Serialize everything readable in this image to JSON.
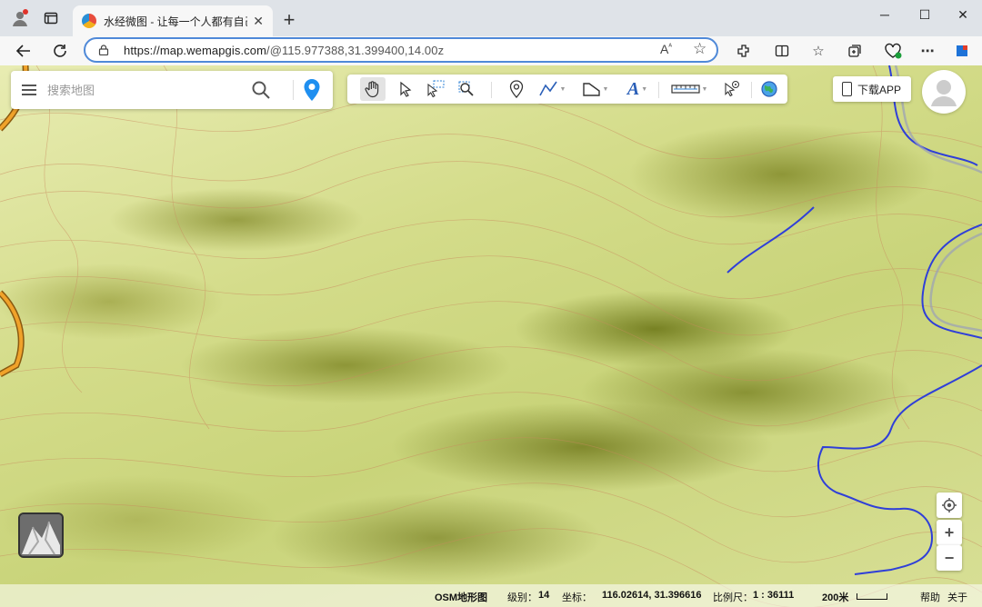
{
  "browser": {
    "tab_title": "水经微图 - 让每一个人都有自己的",
    "url_host": "https://map.wemapgis.com",
    "url_path": "/@115.977388,31.399400,14.00z",
    "read_aloud_label": "Aᵃ"
  },
  "search": {
    "placeholder": "搜索地图"
  },
  "toolbar": {
    "tools": [
      "pan-hand",
      "select-arrow",
      "box-select",
      "zoom-box",
      "marker",
      "polyline",
      "polygon",
      "text",
      "ruler",
      "click-query",
      "globe"
    ],
    "text_tool_label": "A"
  },
  "download_label": "下载APP",
  "statusbar": {
    "layer_name": "OSM地形图",
    "level_label": "级别：",
    "level_value": "14",
    "coord_label": "坐标：",
    "coord_value": "116.02614, 31.396616",
    "scale_label": "比例尺：",
    "scale_value": "1 : 36111",
    "scalebar_label": "200米",
    "help_label": "帮助",
    "about_label": "关于"
  },
  "zoom": {
    "in_label": "+",
    "out_label": "−"
  },
  "colors": {
    "accent": "#4f89d8",
    "pin_blue": "#1f8ff0",
    "river": "#2f3fd8",
    "road_orange": "#f0a22a"
  }
}
